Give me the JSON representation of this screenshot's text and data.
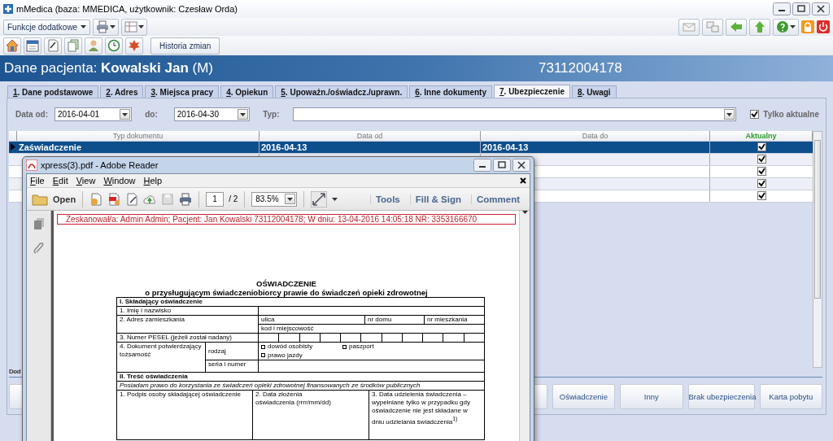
{
  "window": {
    "title": "mMedica  (baza: MMEDICA, użytkownik: Czesław Orda)"
  },
  "toolbar": {
    "functions_menu": "Funkcje dodatkowe",
    "history_button": "Historia zmian"
  },
  "patient": {
    "label": "Dane pacjenta: **Kowalski Jan** (M)",
    "pesel": "73112004178"
  },
  "tabs": [
    {
      "hotkey": "1",
      "label": ". Dane podstawowe",
      "selected": false
    },
    {
      "hotkey": "2",
      "label": ". Adres",
      "selected": false
    },
    {
      "hotkey": "3",
      "label": ". Miejsca pracy",
      "selected": false
    },
    {
      "hotkey": "4",
      "label": ". Opiekun",
      "selected": false
    },
    {
      "hotkey": "5",
      "label": ". Upoważn./oświadcz./uprawn.",
      "selected": false
    },
    {
      "hotkey": "6",
      "label": ". Inne dokumenty",
      "selected": false
    },
    {
      "hotkey": "7",
      "label": ". Ubezpieczenie",
      "selected": true
    },
    {
      "hotkey": "8",
      "label": ". Uwagi",
      "selected": false
    }
  ],
  "filters": {
    "date_from_label": "Data od:",
    "date_from": "2016-04-01",
    "date_to_label": "do:",
    "date_to": "2016-04-30",
    "type_label": "Typ:",
    "only_current": {
      "label": "Tylko aktualne",
      "checked": true
    }
  },
  "table": {
    "columns": [
      "Typ dokumentu",
      "Data od",
      "Data do",
      "Aktualny"
    ],
    "rows": [
      {
        "type": "Zaświadczenie",
        "date_from": "2016-04-13",
        "date_to": "2016-04-13",
        "current": true,
        "selected": true
      },
      {
        "current": true,
        "selected": false
      },
      {
        "current": true,
        "selected": false
      },
      {
        "current": true,
        "selected": false
      },
      {
        "current": true,
        "selected": false
      }
    ]
  },
  "bottom": {
    "section_label": "Dod",
    "buttons": [
      "Oświadczenie",
      "Inny",
      "Brak ubezpieczenia",
      "Karta pobytu"
    ]
  },
  "pdf_viewer": {
    "title": "xpress(3).pdf - Adobe Reader",
    "menu": [
      "File",
      "Edit",
      "View",
      "Window",
      "Help"
    ],
    "open": "Open",
    "page": "1",
    "page_total": "/ 2",
    "zoom": "83.5%",
    "tools": [
      "Tools",
      "Fill & Sign",
      "Comment"
    ],
    "stamp": "Zeskanował/a: Admin Admin; Pacjent: Jan Kowalski 73112004178; W dniu: 13-04-2016 14:05:18 NR: 3353166670",
    "document": {
      "title": "OŚWIADCZENIE",
      "subtitle": "o przysługującym świadczeniobiorcy prawie do świadczeń opieki zdrowotnej",
      "section_1": "I. Składający oświadczenie",
      "name_label": "1. Imię i nazwisko",
      "address_label": "2. Adres zamieszkania",
      "street": "ulica",
      "house_no": "nr domu",
      "flat_no": "nr mieszkania",
      "city": "kod  i miejscowość",
      "pesel_label": "3. Numer PESEL (jeżeli został nadany)",
      "id_label": "4. Dokument potwierdzający tożsamość",
      "kind_label": "rodzaj",
      "id_options": [
        {
          "label": "dowód osobisty",
          "checked": false
        },
        {
          "label": "paszport",
          "checked": false
        },
        {
          "label": "prawo jazdy",
          "checked": false
        }
      ],
      "series_label": "seria i numer",
      "section_2": "II. Treść oświadczenia",
      "statement": "Posiadam prawo do korzystania ze świadczeń opieki zdrowotnej finansowanych ze środków publicznych",
      "signature_label": "1. Podpis osoby składającej oświadczenie",
      "date_label": "2. Data złożenia oświadczenia (rrrr/mm/dd)",
      "service_date_label": "3. Data udzielenia świadczenia – wypełniane tylko w przypadku gdy oświadczenie nie jest składane w dniu udzielania świadczenia$^{1)}$"
    }
  }
}
